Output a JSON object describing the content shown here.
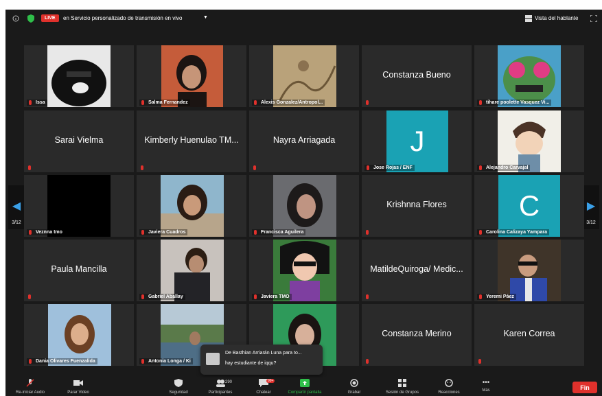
{
  "top_bar": {
    "live_badge": "LIVE",
    "stream_title": "en Servicio personalizado de transmisión en vivo",
    "speaker_view_label": "Vista del hablante"
  },
  "navigation": {
    "left_page": "3/12",
    "right_page": "3/12"
  },
  "participants": [
    {
      "name": "Issa",
      "video": true
    },
    {
      "name": "Salma Fernandez",
      "video": true
    },
    {
      "name": "Alexis Gonzalez/Antropol...",
      "video": true
    },
    {
      "name": "Constanza Bueno",
      "video": false
    },
    {
      "name": "tihare poolette Vasquez Vi...",
      "video": true
    },
    {
      "name": "Sarai Vielma",
      "video": false
    },
    {
      "name": "Kimberly Huenulao TM...",
      "video": false
    },
    {
      "name": "Nayra Arriagada",
      "video": false
    },
    {
      "name": "Jose Rojas / ENF",
      "avatar_letter": "J"
    },
    {
      "name": "Alejandro Carvajal",
      "video": true
    },
    {
      "name": "Veznna tmo",
      "video": true
    },
    {
      "name": "Javiera Cuadros",
      "video": true
    },
    {
      "name": "Francisca Aguilera",
      "video": true
    },
    {
      "name": "Krishnna Flores",
      "video": false
    },
    {
      "name": "Carolina Calizaya Yampara",
      "avatar_letter": "C"
    },
    {
      "name": "Paula Mancilla",
      "video": false
    },
    {
      "name": "Gabriel Aballay",
      "video": true
    },
    {
      "name": "Javiera TMO",
      "video": true
    },
    {
      "name": "MatildeQuiroga/ Medic...",
      "video": false
    },
    {
      "name": "Yeremi Páez",
      "video": true
    },
    {
      "name": "Dania Olivares Fuenzalida",
      "video": true
    },
    {
      "name": "Antonia Longa / Ki",
      "video": true
    },
    {
      "name": "",
      "video": true
    },
    {
      "name": "Constanza Merino",
      "video": false
    },
    {
      "name": "Karen Correa",
      "video": false
    }
  ],
  "chat_toast": {
    "line1": "De Basthian Arriarán Luna para to...",
    "line2": "hay estudiante de iqqu?"
  },
  "toolbar": {
    "audio": "Re-iniciar Audio",
    "video": "Parar Video",
    "security": "Seguridad",
    "participants": "Participantes",
    "participants_count": "290",
    "chat": "Chatear",
    "chat_badge": "99+",
    "share": "Compartir pantalla",
    "record": "Grabar",
    "rooms": "Sesión de Grupos",
    "reactions": "Reacciones",
    "more": "Más",
    "end": "Fin"
  },
  "colors": {
    "accent_blue": "#3aa0e8",
    "tile_bg": "#2a2a2a",
    "end_red": "#e0312c",
    "avatar_teal": "#1aa2b4"
  }
}
